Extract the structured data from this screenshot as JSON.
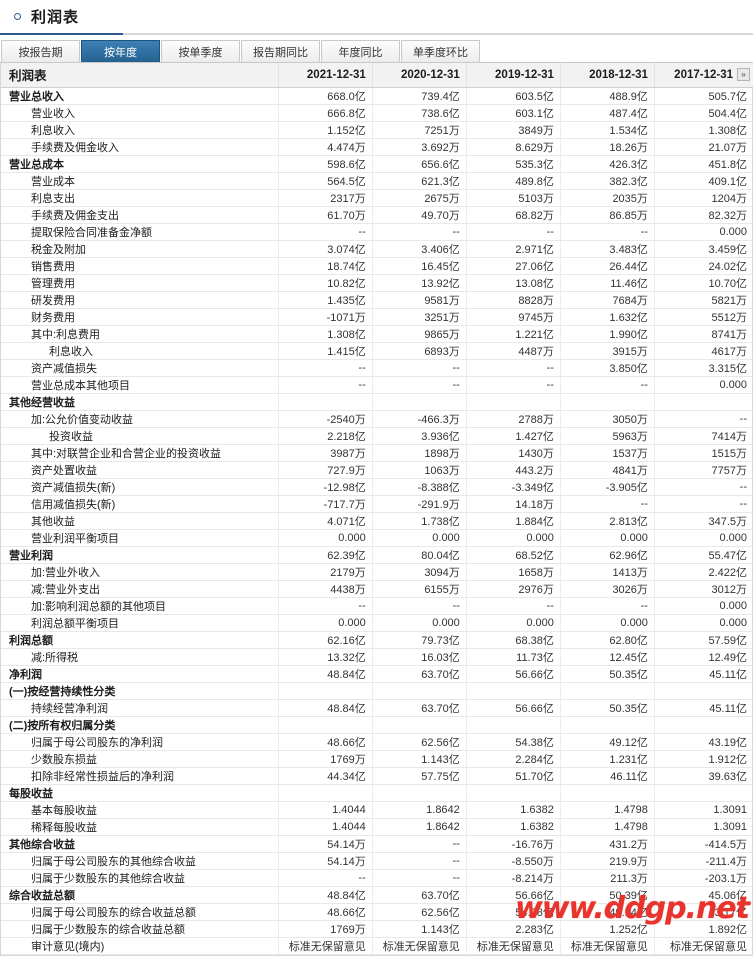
{
  "header": {
    "title": "利润表",
    "bullet_icon": "circle-icon"
  },
  "tabs": [
    {
      "label": "按报告期",
      "active": false
    },
    {
      "label": "按年度",
      "active": true
    },
    {
      "label": "按单季度",
      "active": false
    },
    {
      "label": "报告期同比",
      "active": false
    },
    {
      "label": "年度同比",
      "active": false
    },
    {
      "label": "单季度环比",
      "active": false
    }
  ],
  "table": {
    "label_header": "利润表",
    "columns": [
      "2021-12-31",
      "2020-12-31",
      "2019-12-31",
      "2018-12-31",
      "2017-12-31"
    ],
    "scroll_more_label": "»",
    "rows": [
      {
        "label": "营业总收入",
        "level": 0,
        "values": [
          "668.0亿",
          "739.4亿",
          "603.5亿",
          "488.9亿",
          "505.7亿"
        ]
      },
      {
        "label": "营业收入",
        "level": 1,
        "values": [
          "666.8亿",
          "738.6亿",
          "603.1亿",
          "487.4亿",
          "504.4亿"
        ]
      },
      {
        "label": "利息收入",
        "level": 1,
        "values": [
          "1.152亿",
          "7251万",
          "3849万",
          "1.534亿",
          "1.308亿"
        ]
      },
      {
        "label": "手续费及佣金收入",
        "level": 1,
        "values": [
          "4.474万",
          "3.692万",
          "8.629万",
          "18.26万",
          "21.07万"
        ]
      },
      {
        "label": "营业总成本",
        "level": 0,
        "values": [
          "598.6亿",
          "656.6亿",
          "535.3亿",
          "426.3亿",
          "451.8亿"
        ]
      },
      {
        "label": "营业成本",
        "level": 1,
        "values": [
          "564.5亿",
          "621.3亿",
          "489.8亿",
          "382.3亿",
          "409.1亿"
        ]
      },
      {
        "label": "利息支出",
        "level": 1,
        "values": [
          "2317万",
          "2675万",
          "5103万",
          "2035万",
          "1204万"
        ]
      },
      {
        "label": "手续费及佣金支出",
        "level": 1,
        "values": [
          "61.70万",
          "49.70万",
          "68.82万",
          "86.85万",
          "82.32万"
        ]
      },
      {
        "label": "提取保险合同准备金净额",
        "level": 1,
        "values": [
          "--",
          "--",
          "--",
          "--",
          "0.000"
        ]
      },
      {
        "label": "税金及附加",
        "level": 1,
        "values": [
          "3.074亿",
          "3.406亿",
          "2.971亿",
          "3.483亿",
          "3.459亿"
        ]
      },
      {
        "label": "销售费用",
        "level": 1,
        "values": [
          "18.74亿",
          "16.45亿",
          "27.06亿",
          "26.44亿",
          "24.02亿"
        ]
      },
      {
        "label": "管理费用",
        "level": 1,
        "values": [
          "10.82亿",
          "13.92亿",
          "13.08亿",
          "11.46亿",
          "10.70亿"
        ]
      },
      {
        "label": "研发费用",
        "level": 1,
        "values": [
          "1.435亿",
          "9581万",
          "8828万",
          "7684万",
          "5821万"
        ]
      },
      {
        "label": "财务费用",
        "level": 1,
        "values": [
          "-1071万",
          "3251万",
          "9745万",
          "1.632亿",
          "5512万"
        ]
      },
      {
        "label": "其中:利息费用",
        "level": 1,
        "values": [
          "1.308亿",
          "9865万",
          "1.221亿",
          "1.990亿",
          "8741万"
        ]
      },
      {
        "label": "利息收入",
        "level": 2,
        "values": [
          "1.415亿",
          "6893万",
          "4487万",
          "3915万",
          "4617万"
        ]
      },
      {
        "label": "资产减值损失",
        "level": 1,
        "values": [
          "--",
          "--",
          "--",
          "3.850亿",
          "3.315亿"
        ]
      },
      {
        "label": "营业总成本其他项目",
        "level": 1,
        "values": [
          "--",
          "--",
          "--",
          "--",
          "0.000"
        ]
      },
      {
        "label": "其他经营收益",
        "level": 0,
        "values": [
          "",
          "",
          "",
          "",
          ""
        ]
      },
      {
        "label": "加:公允价值变动收益",
        "level": 1,
        "values": [
          "-2540万",
          "-466.3万",
          "2788万",
          "3050万",
          "--"
        ]
      },
      {
        "label": "投资收益",
        "level": 2,
        "values": [
          "2.218亿",
          "3.936亿",
          "1.427亿",
          "5963万",
          "7414万"
        ]
      },
      {
        "label": "其中:对联营企业和合营企业的投资收益",
        "level": 1,
        "values": [
          "3987万",
          "1898万",
          "1430万",
          "1537万",
          "1515万"
        ]
      },
      {
        "label": "资产处置收益",
        "level": 1,
        "values": [
          "727.9万",
          "1063万",
          "443.2万",
          "4841万",
          "7757万"
        ]
      },
      {
        "label": "资产减值损失(新)",
        "level": 1,
        "values": [
          "-12.98亿",
          "-8.388亿",
          "-3.349亿",
          "-3.905亿",
          "--"
        ]
      },
      {
        "label": "信用减值损失(新)",
        "level": 1,
        "values": [
          "-717.7万",
          "-291.9万",
          "14.18万",
          "--",
          "--"
        ]
      },
      {
        "label": "其他收益",
        "level": 1,
        "values": [
          "4.071亿",
          "1.738亿",
          "1.884亿",
          "2.813亿",
          "347.5万"
        ]
      },
      {
        "label": "营业利润平衡项目",
        "level": 1,
        "values": [
          "0.000",
          "0.000",
          "0.000",
          "0.000",
          "0.000"
        ]
      },
      {
        "label": "营业利润",
        "level": 0,
        "values": [
          "62.39亿",
          "80.04亿",
          "68.52亿",
          "62.96亿",
          "55.47亿"
        ]
      },
      {
        "label": "加:营业外收入",
        "level": 1,
        "values": [
          "2179万",
          "3094万",
          "1658万",
          "1413万",
          "2.422亿"
        ]
      },
      {
        "label": "减:营业外支出",
        "level": 1,
        "values": [
          "4438万",
          "6155万",
          "2976万",
          "3026万",
          "3012万"
        ]
      },
      {
        "label": "加:影响利润总额的其他项目",
        "level": 1,
        "values": [
          "--",
          "--",
          "--",
          "--",
          "0.000"
        ]
      },
      {
        "label": "利润总额平衡项目",
        "level": 1,
        "values": [
          "0.000",
          "0.000",
          "0.000",
          "0.000",
          "0.000"
        ]
      },
      {
        "label": "利润总额",
        "level": 0,
        "values": [
          "62.16亿",
          "79.73亿",
          "68.38亿",
          "62.80亿",
          "57.59亿"
        ]
      },
      {
        "label": "减:所得税",
        "level": 1,
        "values": [
          "13.32亿",
          "16.03亿",
          "11.73亿",
          "12.45亿",
          "12.49亿"
        ]
      },
      {
        "label": "净利润",
        "level": 0,
        "values": [
          "48.84亿",
          "63.70亿",
          "56.66亿",
          "50.35亿",
          "45.11亿"
        ]
      },
      {
        "label": "(一)按经营持续性分类",
        "level": 0,
        "values": [
          "",
          "",
          "",
          "",
          ""
        ]
      },
      {
        "label": "持续经营净利润",
        "level": 1,
        "values": [
          "48.84亿",
          "63.70亿",
          "56.66亿",
          "50.35亿",
          "45.11亿"
        ]
      },
      {
        "label": "(二)按所有权归属分类",
        "level": 0,
        "values": [
          "",
          "",
          "",
          "",
          ""
        ]
      },
      {
        "label": "归属于母公司股东的净利润",
        "level": 1,
        "values": [
          "48.66亿",
          "62.56亿",
          "54.38亿",
          "49.12亿",
          "43.19亿"
        ]
      },
      {
        "label": "少数股东损益",
        "level": 1,
        "values": [
          "1769万",
          "1.143亿",
          "2.284亿",
          "1.231亿",
          "1.912亿"
        ]
      },
      {
        "label": "扣除非经常性损益后的净利润",
        "level": 1,
        "values": [
          "44.34亿",
          "57.75亿",
          "51.70亿",
          "46.11亿",
          "39.63亿"
        ]
      },
      {
        "label": "每股收益",
        "level": 0,
        "values": [
          "",
          "",
          "",
          "",
          ""
        ]
      },
      {
        "label": "基本每股收益",
        "level": 1,
        "values": [
          "1.4044",
          "1.8642",
          "1.6382",
          "1.4798",
          "1.3091"
        ]
      },
      {
        "label": "稀释每股收益",
        "level": 1,
        "values": [
          "1.4044",
          "1.8642",
          "1.6382",
          "1.4798",
          "1.3091"
        ]
      },
      {
        "label": "其他综合收益",
        "level": 0,
        "values": [
          "54.14万",
          "--",
          "-16.76万",
          "431.2万",
          "-414.5万"
        ]
      },
      {
        "label": "归属于母公司股东的其他综合收益",
        "level": 1,
        "values": [
          "54.14万",
          "--",
          "-8.550万",
          "219.9万",
          "-211.4万"
        ]
      },
      {
        "label": "归属于少数股东的其他综合收益",
        "level": 1,
        "values": [
          "--",
          "--",
          "-8.214万",
          "211.3万",
          "-203.1万"
        ]
      },
      {
        "label": "综合收益总额",
        "level": 0,
        "values": [
          "48.84亿",
          "63.70亿",
          "56.66亿",
          "50.39亿",
          "45.06亿"
        ]
      },
      {
        "label": "归属于母公司股东的综合收益总额",
        "level": 1,
        "values": [
          "48.66亿",
          "62.56亿",
          "54.38亿",
          "49.14亿",
          "43.17亿"
        ]
      },
      {
        "label": "归属于少数股东的综合收益总额",
        "level": 1,
        "values": [
          "1769万",
          "1.143亿",
          "2.283亿",
          "1.252亿",
          "1.892亿"
        ]
      },
      {
        "label": "审计意见(境内)",
        "level": 1,
        "values": [
          "标准无保留意见",
          "标准无保留意见",
          "标准无保留意见",
          "标准无保留意见",
          "标准无保留意见"
        ]
      }
    ]
  },
  "watermark": {
    "text": "www.ddgp.net",
    "color": "#e8342c"
  }
}
